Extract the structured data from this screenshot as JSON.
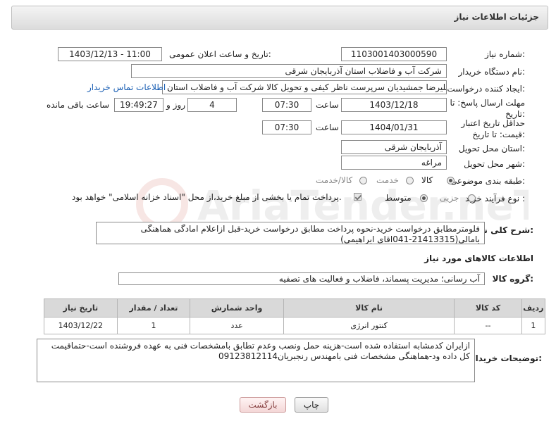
{
  "header": {
    "title": "جزئیات اطلاعات نیاز"
  },
  "fields": {
    "need_number": {
      "label": "شماره نیاز:",
      "value": "1103001403000590"
    },
    "announce_datetime": {
      "label": "تاریخ و ساعت اعلان عمومی:",
      "value": "1403/12/13 - 11:00"
    },
    "buyer_org": {
      "label": "نام دستگاه خریدار:",
      "value": "شرکت آب و فاضلاب استان آذربایجان شرقی"
    },
    "requester": {
      "label": "ایجاد کننده درخواست:",
      "value": "علیرضا جمشیدیان سرپرست ناظر کیفی و تحویل کالا شرکت آب و فاضلاب استان",
      "contact_link": "اطلاعات تماس خریدار"
    },
    "reply_deadline": {
      "label": "مهلت ارسال پاسخ: تا تاریخ:",
      "date": "1403/12/18",
      "time_label": "ساعت",
      "time": "07:30",
      "days": "4",
      "days_label": "روز و",
      "remaining": "19:49:27",
      "remaining_label": "ساعت باقی مانده"
    },
    "price_validity": {
      "label": "حداقل تاریخ اعتبار قیمت: تا تاریخ:",
      "date": "1404/01/31",
      "time_label": "ساعت",
      "time": "07:30"
    },
    "delivery_province": {
      "label": "استان محل تحویل:",
      "value": "آذربایجان شرقی"
    },
    "delivery_city": {
      "label": "شهر محل تحویل:",
      "value": "مراغه"
    },
    "category": {
      "label": "طبقه بندی موضوعی:",
      "options": [
        "کالا",
        "خدمت",
        "کالا/خدمت"
      ],
      "selected": "کالا"
    },
    "process_type": {
      "label": "نوع فرآیند خرید :",
      "options": [
        "جزیی",
        "متوسط"
      ],
      "selected": "متوسط",
      "payment_note": "پرداخت تمام یا بخشی از مبلغ خرید،از محل \"اسناد خزانه اسلامی\" خواهد بود."
    },
    "general_desc": {
      "label": "شرح کلی نیاز:",
      "value": "فلومترمطابق درخواست خرید-نحوه پرداخت مطابق درخواست خرید-قبل ازاعلام امادگی هماهنگی بامالی(21413315-041اقای ابراهیمی)"
    }
  },
  "goods_section": {
    "title": "اطلاعات کالاهای مورد نیاز",
    "group_label": "گروه کالا:",
    "group_value": "آب رسانی؛ مدیریت پسماند، فاضلاب و فعالیت های تصفیه"
  },
  "table": {
    "headers": [
      "ردیف",
      "کد کالا",
      "نام کالا",
      "واحد شمارش",
      "تعداد / مقدار",
      "تاریخ نیاز"
    ],
    "rows": [
      [
        "1",
        "--",
        "کنتور انرژی",
        "عدد",
        "1",
        "1403/12/22"
      ]
    ]
  },
  "buyer_notes": {
    "label": "توضیحات خریدار:",
    "value": "ازایران کدمشابه استفاده شده است-هزینه حمل ونصب وعدم تطابق بامشخصات فنی به عهده فروشنده است-حتماقیمت کل داده ود-هماهنگی مشخصات فنی بامهندس رنجبریان09123812114"
  },
  "buttons": {
    "print": "چاپ",
    "back": "بازگشت"
  },
  "watermark_text": "AriaTender.neT"
}
